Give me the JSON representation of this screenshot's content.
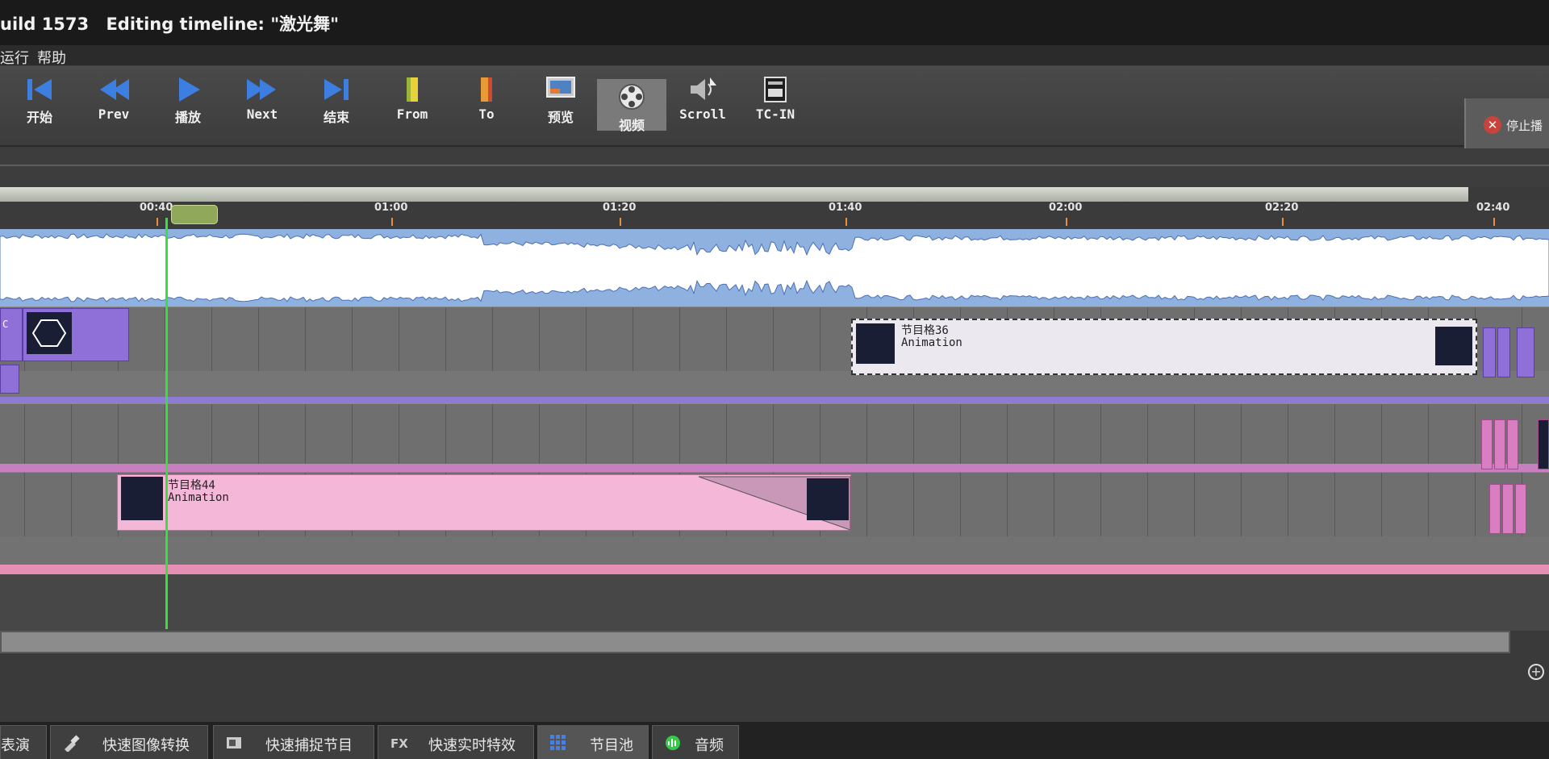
{
  "window": {
    "build": "uild 1573",
    "editing": "Editing timeline: \"激光舞\""
  },
  "menu": {
    "items": [
      "运行",
      "帮助"
    ]
  },
  "toolbar": {
    "start": "开始",
    "prev": "Prev",
    "play": "播放",
    "next": "Next",
    "end": "结束",
    "from": "From",
    "to": "To",
    "preview": "预览",
    "video": "视频",
    "scroll": "Scroll",
    "tc_in": "TC-IN",
    "stop": "停止播"
  },
  "ruler": {
    "ticks": [
      "00:40",
      "01:00",
      "01:20",
      "01:40",
      "02:00",
      "02:20",
      "02:40"
    ]
  },
  "clips": {
    "clip_a_prefix": "C",
    "clip36_name": "节目格36",
    "clip36_type": "Animation",
    "clip44_name": "节目格44",
    "clip44_type": "Animation"
  },
  "bottom_tabs": {
    "tab1": "表演",
    "tab2": "快速图像转换",
    "tab3": "快速捕捉节目",
    "tab4": "快速实时特效",
    "tab5": "节目池",
    "tab6": "音频"
  },
  "colors": {
    "audio_waveform": "#ffffff",
    "audio_bg": "#8fb1e0",
    "purple_clip": "#8e70d8",
    "pink_clip": "#f5b7d8",
    "playhead": "#37e03c",
    "ruler_tick": "#e89038"
  }
}
